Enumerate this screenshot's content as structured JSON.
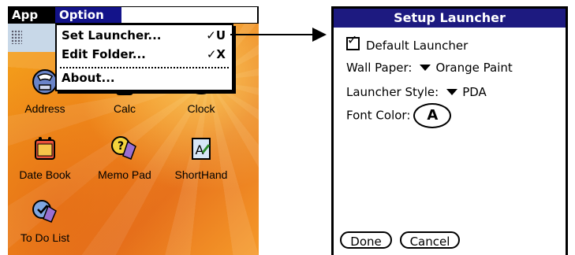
{
  "left": {
    "menubar": {
      "app": "App",
      "option": "Option"
    },
    "dropdown": {
      "items": [
        {
          "label": "Set Launcher...",
          "shortcut": "✓U"
        },
        {
          "label": "Edit Folder...",
          "shortcut": "✓X"
        },
        {
          "label": "About...",
          "shortcut": ""
        }
      ]
    },
    "apps": [
      {
        "label": "Address",
        "icon": "address-icon"
      },
      {
        "label": "Calc",
        "icon": "calc-icon"
      },
      {
        "label": "Clock",
        "icon": "clock-icon"
      },
      {
        "label": "Date Book",
        "icon": "datebook-icon"
      },
      {
        "label": "Memo Pad",
        "icon": "memopad-icon"
      },
      {
        "label": "ShortHand",
        "icon": "shorthand-icon"
      },
      {
        "label": "To Do List",
        "icon": "todo-icon"
      }
    ]
  },
  "dialog": {
    "title": "Setup Launcher",
    "default_launcher": {
      "label": "Default Launcher",
      "checked": true
    },
    "wallpaper": {
      "label": "Wall Paper:",
      "value": "Orange Paint"
    },
    "launcher_style": {
      "label": "Launcher Style:",
      "value": "PDA"
    },
    "font_color": {
      "label": "Font Color:",
      "value": "A"
    },
    "buttons": {
      "done": "Done",
      "cancel": "Cancel"
    }
  },
  "colors": {
    "title_bar": "#1d1a80",
    "menu_highlight": "#13138a",
    "wallpaper": "#f0881a"
  }
}
